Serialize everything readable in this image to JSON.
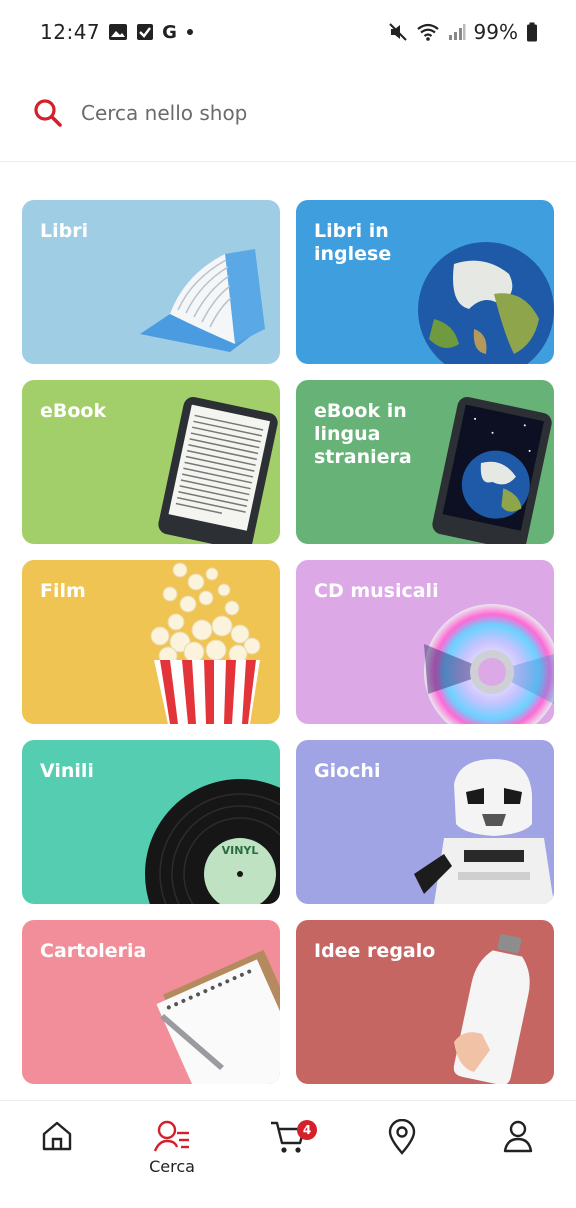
{
  "status_bar": {
    "time": "12:47",
    "battery": "99%",
    "left_icons": [
      "image-icon",
      "check-square-icon",
      "google-icon",
      "dot-icon"
    ],
    "right_icons": [
      "mute-icon",
      "wifi-icon",
      "signal-icon",
      "battery-icon"
    ]
  },
  "search": {
    "placeholder": "Cerca nello shop",
    "icon_color": "#d3202a"
  },
  "categories": [
    {
      "label": "Libri",
      "color": "#9fcde4",
      "art": "book"
    },
    {
      "label": "Libri in inglese",
      "color": "#3f9edd",
      "art": "globe"
    },
    {
      "label": "eBook",
      "color": "#a3cf6a",
      "art": "ereader"
    },
    {
      "label": "eBook in lingua straniera",
      "color": "#66b277",
      "art": "ereader-globe"
    },
    {
      "label": "Film",
      "color": "#f0c453",
      "art": "popcorn"
    },
    {
      "label": "CD musicali",
      "color": "#dca8e6",
      "art": "cd"
    },
    {
      "label": "Vinili",
      "color": "#55cdb1",
      "art": "vinyl"
    },
    {
      "label": "Giochi",
      "color": "#a0a4e4",
      "art": "stormtrooper"
    },
    {
      "label": "Cartoleria",
      "color": "#f28e99",
      "art": "notebook"
    },
    {
      "label": "Idee regalo",
      "color": "#c56663",
      "art": "bottle"
    }
  ],
  "vinyl_label": "VINYL",
  "bottom_nav": {
    "items": [
      {
        "name": "home",
        "label": ""
      },
      {
        "name": "search",
        "label": "Cerca"
      },
      {
        "name": "cart",
        "label": ""
      },
      {
        "name": "stores",
        "label": ""
      },
      {
        "name": "account",
        "label": ""
      }
    ],
    "cart_badge": "4",
    "active_color": "#d3202a"
  }
}
